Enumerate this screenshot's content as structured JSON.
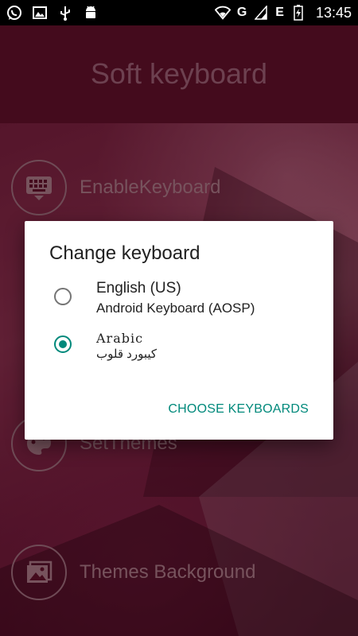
{
  "status_bar": {
    "network": "G",
    "network2": "E",
    "time": "13:45",
    "icons": [
      "whatsapp-icon",
      "image-icon",
      "usb-icon",
      "android-icon",
      "wifi-icon",
      "signal-icon",
      "battery-icon"
    ]
  },
  "app": {
    "title": "Soft keyboard",
    "menu": [
      {
        "label": "EnableKeyboard",
        "icon": "keyboard-icon"
      },
      {
        "label": "SetThemes",
        "icon": "palette-icon"
      },
      {
        "label": "Themes Background",
        "icon": "gallery-icon"
      }
    ]
  },
  "dialog": {
    "title": "Change keyboard",
    "options": [
      {
        "title": "English (US)",
        "subtitle": "Android Keyboard (AOSP)",
        "selected": false
      },
      {
        "title": "Arabic",
        "subtitle": "كيبورد قلوب",
        "selected": true
      }
    ],
    "action_label": "CHOOSE KEYBOARDS"
  },
  "colors": {
    "accent": "#00897b",
    "app_background": "#6e1230"
  }
}
